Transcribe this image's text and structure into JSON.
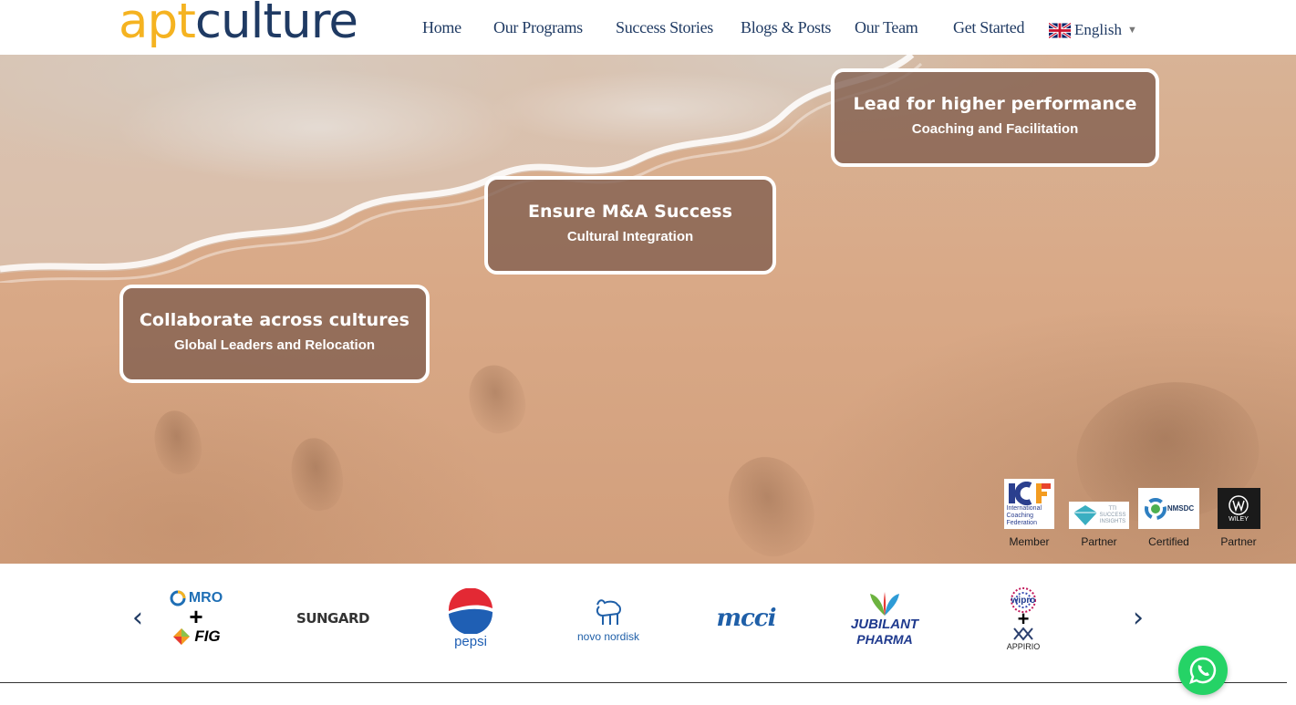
{
  "brand": {
    "logo_part1": "apt",
    "logo_part2": "culture"
  },
  "nav": {
    "items": [
      {
        "label": "Home"
      },
      {
        "label": "Our Programs"
      },
      {
        "label": "Success Stories"
      },
      {
        "label": "Blogs & Posts"
      },
      {
        "label": "Our Team"
      },
      {
        "label": "Get Started"
      }
    ],
    "language": {
      "label": "English",
      "icon": "uk-flag-icon"
    }
  },
  "hero": {
    "cards": [
      {
        "title": "Lead for higher performance",
        "subtitle": "Coaching and Facilitation"
      },
      {
        "title": "Ensure M&A Success",
        "subtitle": "Cultural Integration"
      },
      {
        "title": "Collaborate across cultures",
        "subtitle": "Global Leaders and Relocation"
      }
    ],
    "badges": [
      {
        "org": "ICF",
        "org_text": "International Coaching Federation",
        "caption": "Member"
      },
      {
        "org": "TTI",
        "org_text": "TTI SUCCESS INSIGHTS",
        "caption": "Partner"
      },
      {
        "org": "NMSDC",
        "org_text": "NMSDC",
        "caption": "Certified"
      },
      {
        "org": "WILEY",
        "org_text": "WILEY",
        "caption": "Partner"
      }
    ]
  },
  "clients": {
    "prev_icon": "chevron-left-icon",
    "next_icon": "chevron-right-icon",
    "logos": [
      {
        "name": "MRO",
        "name2": "FIG"
      },
      {
        "name": "SUNGARD"
      },
      {
        "name": "pepsi"
      },
      {
        "name": "novo nordisk"
      },
      {
        "name": "mcci"
      },
      {
        "name": "JUBILANT",
        "name2": "PHARMA"
      },
      {
        "name": "wipro",
        "name2": "APPIRIO"
      }
    ]
  },
  "whatsapp": {
    "icon": "whatsapp-icon"
  },
  "colors": {
    "navy": "#1f3a63",
    "gold": "#f5b321",
    "card_bg": "#805e4e",
    "whatsapp": "#25d366"
  }
}
